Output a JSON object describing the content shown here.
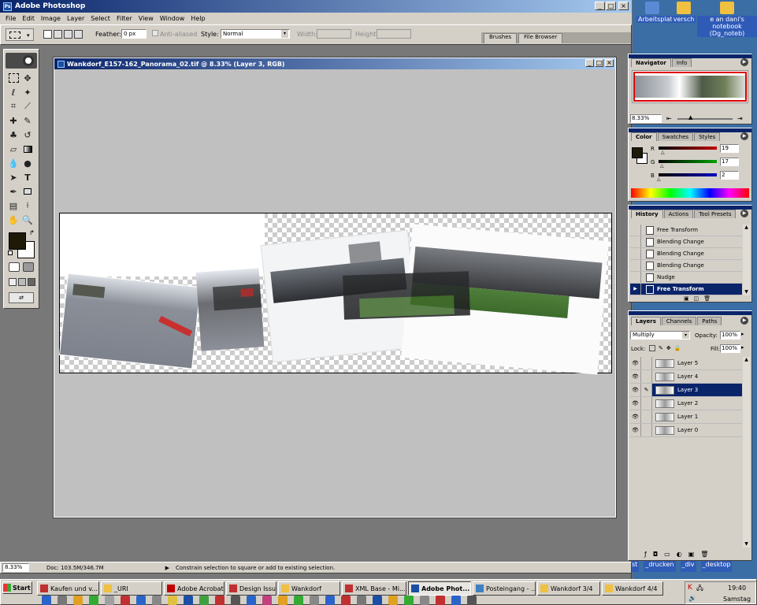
{
  "app": {
    "title": "Adobe Photoshop"
  },
  "menu": [
    "File",
    "Edit",
    "Image",
    "Layer",
    "Select",
    "Filter",
    "View",
    "Window",
    "Help"
  ],
  "options": {
    "feather_label": "Feather:",
    "feather_value": "0 px",
    "antialiased_label": "Anti-aliased",
    "style_label": "Style:",
    "style_value": "Normal",
    "width_label": "Width:",
    "height_label": "Height:",
    "well_tabs": [
      "Brushes",
      "File Browser"
    ]
  },
  "desktop": {
    "icons": [
      {
        "label": "Arbeitsplatz",
        "icon": "computer-icon"
      },
      {
        "label": "versch",
        "icon": "folder-icon"
      },
      {
        "label": "e an dani's notebook (Dg_noteb)",
        "icon": "network-drive-icon"
      }
    ],
    "right_labels": [
      "st",
      "_drucken",
      "_div",
      "_desktop"
    ]
  },
  "document": {
    "title": "Wankdorf_E157-162_Panorama_02.tif @ 8.33% (Layer 3, RGB)"
  },
  "navigator": {
    "tabs": [
      "Navigator",
      "Info"
    ],
    "zoom": "8.33%"
  },
  "color": {
    "tabs": [
      "Color",
      "Swatches",
      "Styles"
    ],
    "channels": [
      {
        "label": "R",
        "value": "19",
        "color": "#c00000"
      },
      {
        "label": "G",
        "value": "17",
        "color": "#00a000"
      },
      {
        "label": "B",
        "value": "2",
        "color": "#0000c0"
      }
    ],
    "foreground": "#1f1a08"
  },
  "history": {
    "tabs": [
      "History",
      "Actions",
      "Tool Presets"
    ],
    "items": [
      "Free Transform",
      "Blending Change",
      "Blending Change",
      "Blending Change",
      "Nudge",
      "Free Transform"
    ]
  },
  "layers": {
    "tabs": [
      "Layers",
      "Channels",
      "Paths"
    ],
    "blend_mode": "Multiply",
    "opacity_label": "Opacity:",
    "opacity_value": "100%",
    "lock_label": "Lock:",
    "fill_label": "Fill:",
    "fill_value": "100%",
    "items": [
      "Layer 5",
      "Layer 4",
      "Layer 3",
      "Layer 2",
      "Layer 1",
      "Layer 0"
    ]
  },
  "status": {
    "zoom": "8.33%",
    "doc": "Doc: 103.5M/346.7M",
    "hint": "Constrain selection to square or add to existing selection."
  },
  "taskbar": {
    "start": "Start",
    "buttons": [
      "Kaufen und v...",
      "_URI",
      "Adobe Acrobat",
      "Design Issue...",
      "Wankdorf",
      "XML Base - Mi...",
      "Adobe Phot...",
      "Posteingang - ...",
      "Wankdorf 3/4",
      "Wankdorf 4/4"
    ],
    "clock": "19:40",
    "day": "Samstag"
  }
}
